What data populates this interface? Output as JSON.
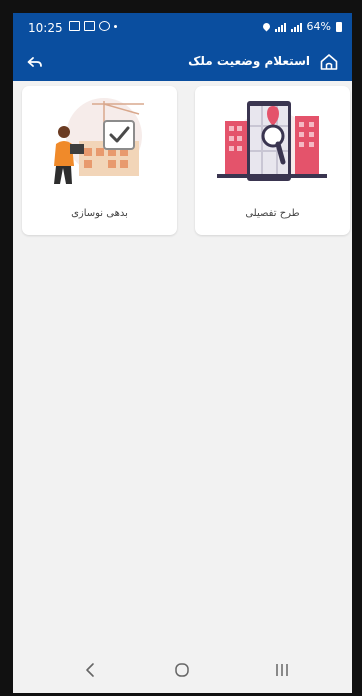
{
  "status_bar": {
    "time": "10:25",
    "battery": "64%"
  },
  "app_bar": {
    "title": "استعلام وضعیت ملک"
  },
  "cards": [
    {
      "label": "طرح تفصیلی",
      "icon": "map-search-icon"
    },
    {
      "label": "بدهی نوسازی",
      "icon": "renovation-check-icon"
    }
  ],
  "nav_bar": {
    "buttons": [
      "back-icon",
      "home-icon",
      "recents-icon"
    ]
  },
  "colors": {
    "primary": "#0a4e9f",
    "background": "#f2f2f2",
    "card": "#ffffff"
  }
}
